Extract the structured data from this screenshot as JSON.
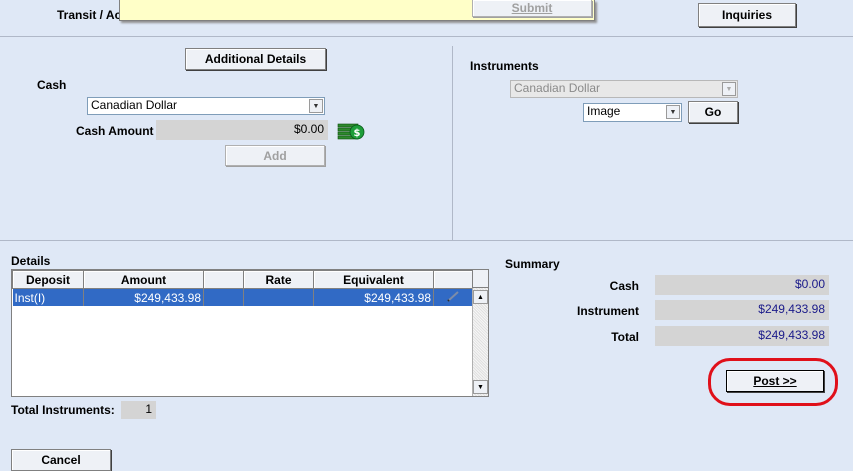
{
  "top": {
    "transit_label": "Transit / Ac",
    "submit_label": "Submit",
    "inquiries_label": "Inquiries"
  },
  "left": {
    "additional_details_label": "Additional Details",
    "cash_heading": "Cash",
    "cash_currency": "Canadian Dollar",
    "cash_amount_label": "Cash Amount",
    "cash_amount_value": "$0.00",
    "add_label": "Add",
    "cash_icon": "money-stack-icon"
  },
  "instruments": {
    "heading": "Instruments",
    "currency": "Canadian Dollar",
    "type": "Image",
    "go_label": "Go"
  },
  "details": {
    "heading": "Details",
    "columns": [
      "Deposit",
      "Amount",
      "",
      "Rate",
      "Equivalent",
      ""
    ],
    "rows": [
      {
        "deposit": "Inst(I)",
        "amount": "$249,433.98",
        "blank": "",
        "rate": "",
        "equivalent": "$249,433.98"
      }
    ],
    "total_instruments_label": "Total Instruments:",
    "total_instruments_value": "1"
  },
  "summary": {
    "heading": "Summary",
    "cash_label": "Cash",
    "cash_value": "$0.00",
    "instrument_label": "Instrument",
    "instrument_value": "$249,433.98",
    "total_label": "Total",
    "total_value": "$249,433.98",
    "post_label": "Post >>",
    "highlight_color": "#e0101a"
  },
  "footer": {
    "cancel_label": "Cancel"
  }
}
